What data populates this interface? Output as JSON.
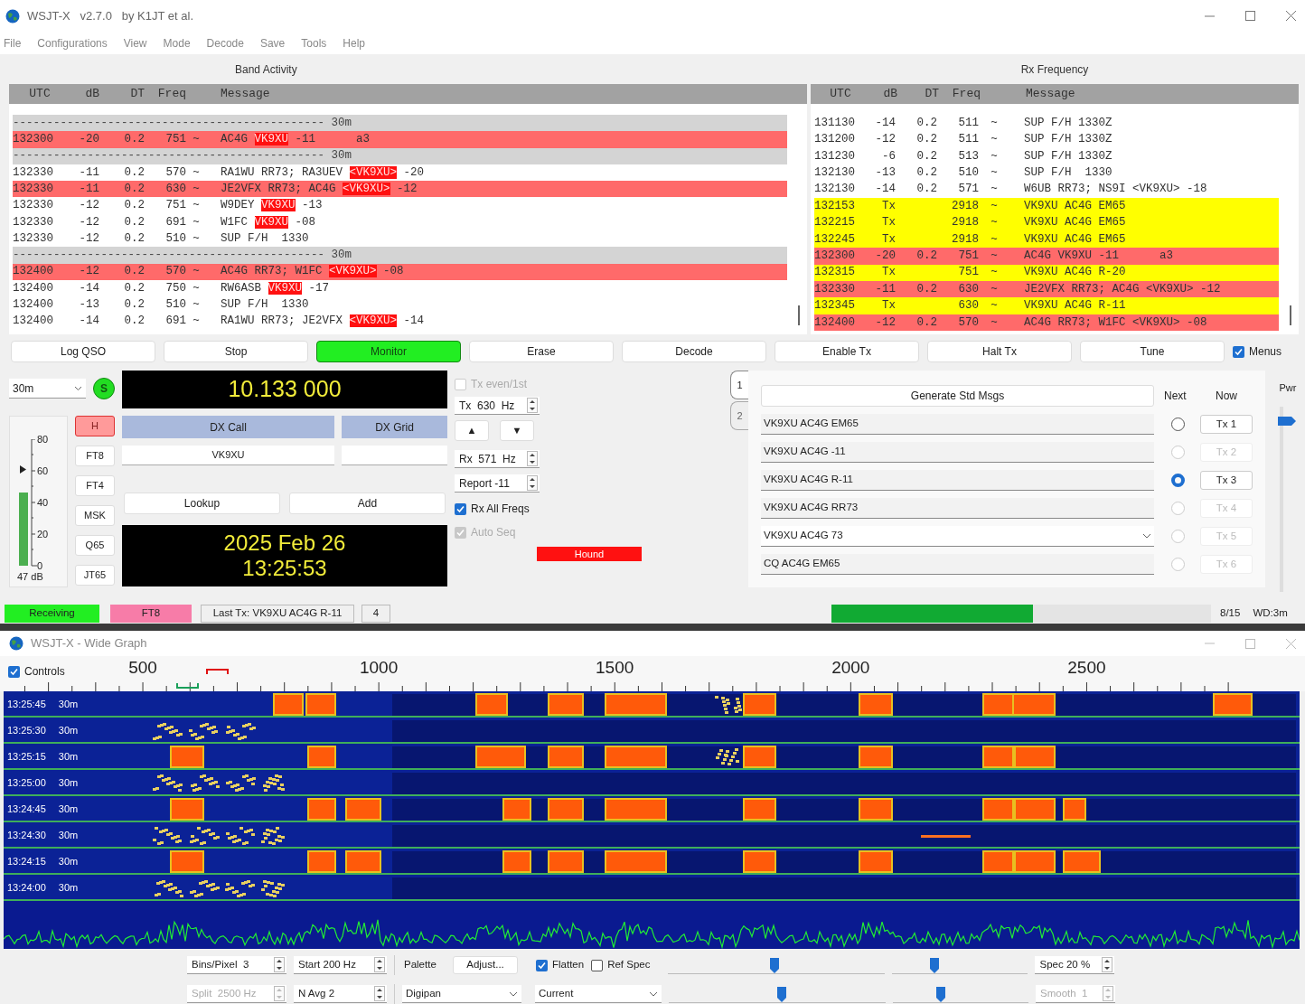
{
  "window": {
    "title": "WSJT-X   v2.7.0   by K1JT et al."
  },
  "menu": [
    "File",
    "Configurations",
    "View",
    "Mode",
    "Decode",
    "Save",
    "Tools",
    "Help"
  ],
  "band_activity": {
    "title": "Band Activity",
    "columns": [
      "UTC",
      "dB",
      "DT",
      "Freq",
      "Message"
    ],
    "rows": [
      {
        "kind": "separator",
        "text": "---------------------------------------------- 30m"
      },
      {
        "kind": "decode",
        "color": "#ff6a6a",
        "utc": "132300",
        "db": "-20",
        "dt": "0.2",
        "freq": "751",
        "sync": "~",
        "message": "AC4G ",
        "call": "VK9XU",
        "after": " -11      a3"
      },
      {
        "kind": "separator",
        "text": "---------------------------------------------- 30m"
      },
      {
        "kind": "decode",
        "color": "#ffffff",
        "utc": "132330",
        "db": "-11",
        "dt": "0.2",
        "freq": "570",
        "sync": "~",
        "message": "RA1WU RR73; RA3UEV ",
        "call": "<VK9XU>",
        "after": " -20"
      },
      {
        "kind": "decode",
        "color": "#ff6a6a",
        "utc": "132330",
        "db": "-11",
        "dt": "0.2",
        "freq": "630",
        "sync": "~",
        "message": "JE2VFX RR73; AC4G ",
        "call": "<VK9XU>",
        "after": " -12"
      },
      {
        "kind": "decode",
        "color": "#ffffff",
        "utc": "132330",
        "db": "-12",
        "dt": "0.2",
        "freq": "751",
        "sync": "~",
        "message": "W9DEY ",
        "call": "VK9XU",
        "after": " -13"
      },
      {
        "kind": "decode",
        "color": "#ffffff",
        "utc": "132330",
        "db": "-12",
        "dt": "0.2",
        "freq": "691",
        "sync": "~",
        "message": "W1FC ",
        "call": "VK9XU",
        "after": " -08"
      },
      {
        "kind": "decode",
        "color": "#ffffff",
        "utc": "132330",
        "db": "-12",
        "dt": "0.2",
        "freq": "510",
        "sync": "~",
        "message": "SUP F/H  1330"
      },
      {
        "kind": "separator",
        "text": "---------------------------------------------- 30m"
      },
      {
        "kind": "decode",
        "color": "#ff6a6a",
        "utc": "132400",
        "db": "-12",
        "dt": "0.2",
        "freq": "570",
        "sync": "~",
        "message": "AC4G RR73; W1FC ",
        "call": "<VK9XU>",
        "after": " -08"
      },
      {
        "kind": "decode",
        "color": "#ffffff",
        "utc": "132400",
        "db": "-14",
        "dt": "0.2",
        "freq": "750",
        "sync": "~",
        "message": "RW6ASB ",
        "call": "VK9XU",
        "after": " -17"
      },
      {
        "kind": "decode",
        "color": "#ffffff",
        "utc": "132400",
        "db": "-13",
        "dt": "0.2",
        "freq": "510",
        "sync": "~",
        "message": "SUP F/H  1330"
      },
      {
        "kind": "decode",
        "color": "#ffffff",
        "utc": "132400",
        "db": "-14",
        "dt": "0.2",
        "freq": "691",
        "sync": "~",
        "message": "RA1WU RR73; JE2VFX ",
        "call": "<VK9XU>",
        "after": " -14"
      }
    ]
  },
  "rx_frequency": {
    "title": "Rx Frequency",
    "columns": [
      "UTC",
      "dB",
      "DT",
      "Freq",
      "Message"
    ],
    "rows": [
      {
        "kind": "decode",
        "color": "#ffffff",
        "utc": "131130",
        "db": "-14",
        "dt": "0.2",
        "freq": "511",
        "sync": "~",
        "message": "SUP F/H 1330Z"
      },
      {
        "kind": "decode",
        "color": "#ffffff",
        "utc": "131200",
        "db": "-12",
        "dt": "0.2",
        "freq": "511",
        "sync": "~",
        "message": "SUP F/H 1330Z"
      },
      {
        "kind": "decode",
        "color": "#ffffff",
        "utc": "131230",
        "db": "-6",
        "dt": "0.2",
        "freq": "513",
        "sync": "~",
        "message": "SUP F/H 1330Z"
      },
      {
        "kind": "decode",
        "color": "#ffffff",
        "utc": "132130",
        "db": "-13",
        "dt": "0.2",
        "freq": "510",
        "sync": "~",
        "message": "SUP F/H  1330"
      },
      {
        "kind": "decode",
        "color": "#ffffff",
        "utc": "132130",
        "db": "-14",
        "dt": "0.2",
        "freq": "571",
        "sync": "~",
        "message": "W6UB RR73; NS9I <VK9XU> -18"
      },
      {
        "kind": "decode",
        "color": "#ffff00",
        "utc": "132153",
        "db": "Tx",
        "freq": "2918",
        "sync": "~",
        "message": "VK9XU AC4G EM65"
      },
      {
        "kind": "decode",
        "color": "#ffff00",
        "utc": "132215",
        "db": "Tx",
        "freq": "2918",
        "sync": "~",
        "message": "VK9XU AC4G EM65"
      },
      {
        "kind": "decode",
        "color": "#ffff00",
        "utc": "132245",
        "db": "Tx",
        "freq": "2918",
        "sync": "~",
        "message": "VK9XU AC4G EM65"
      },
      {
        "kind": "decode",
        "color": "#ff6a6a",
        "utc": "132300",
        "db": "-20",
        "dt": "0.2",
        "freq": "751",
        "sync": "~",
        "message": "AC4G VK9XU -11      a3"
      },
      {
        "kind": "decode",
        "color": "#ffff00",
        "utc": "132315",
        "db": "Tx",
        "freq": "751",
        "sync": "~",
        "message": "VK9XU AC4G R-20"
      },
      {
        "kind": "decode",
        "color": "#ff6a6a",
        "utc": "132330",
        "db": "-11",
        "dt": "0.2",
        "freq": "630",
        "sync": "~",
        "message": "JE2VFX RR73; AC4G <VK9XU> -12"
      },
      {
        "kind": "decode",
        "color": "#ffff00",
        "utc": "132345",
        "db": "Tx",
        "freq": "630",
        "sync": "~",
        "message": "VK9XU AC4G R-11"
      },
      {
        "kind": "decode",
        "color": "#ff6a6a",
        "utc": "132400",
        "db": "-12",
        "dt": "0.2",
        "freq": "570",
        "sync": "~",
        "message": "AC4G RR73; W1FC <VK9XU> -08"
      }
    ]
  },
  "buttons": [
    {
      "label": "Log QSO",
      "on": false
    },
    {
      "label": "Stop",
      "on": false
    },
    {
      "label": "Monitor",
      "on": true
    },
    {
      "label": "Erase",
      "on": false
    },
    {
      "label": "Decode",
      "on": false
    },
    {
      "label": "Enable Tx",
      "on": false
    },
    {
      "label": "Halt Tx",
      "on": false
    },
    {
      "label": "Tune",
      "on": false
    }
  ],
  "menus_checkbox": {
    "label": "Menus",
    "checked": true
  },
  "band": "30m",
  "s_indicator": "S",
  "dial_frequency": "10.133 000",
  "meter": {
    "ticks": [
      "80",
      "60",
      "40",
      "20",
      "0"
    ],
    "reading": "47 dB"
  },
  "modes": [
    {
      "label": "H",
      "selected": true
    },
    {
      "label": "FT8",
      "selected": false
    },
    {
      "label": "FT4",
      "selected": false
    },
    {
      "label": "MSK",
      "selected": false
    },
    {
      "label": "Q65",
      "selected": false
    },
    {
      "label": "JT65",
      "selected": false
    }
  ],
  "dx": {
    "call_label": "DX Call",
    "grid_label": "DX Grid",
    "call": "VK9XU"
  },
  "lookup": "Lookup",
  "add": "Add",
  "clock": {
    "date": "2025 Feb 26",
    "time": "13:25:53"
  },
  "tx_controls": {
    "tx_even": {
      "label": "Tx even/1st",
      "checked": false,
      "disabled": true
    },
    "tx_freq": "Tx  630  Hz",
    "arrows": [
      "▲",
      "▼"
    ],
    "rx_freq": "Rx  571  Hz",
    "report": "Report -11",
    "rx_all": {
      "label": "Rx All Freqs",
      "checked": true,
      "disabled": false
    },
    "auto_seq": {
      "label": "Auto Seq",
      "checked": true,
      "disabled": true
    },
    "hound": "Hound"
  },
  "tabs": [
    {
      "label": "1",
      "selected": true
    },
    {
      "label": "2",
      "selected": false
    }
  ],
  "messages": {
    "generate": "Generate Std Msgs",
    "next_label": "Next",
    "now_label": "Now",
    "rows": [
      {
        "text": "VK9XU AC4G EM65",
        "next": false,
        "now": "Tx 1",
        "enabled": true,
        "dropdown": false
      },
      {
        "text": "VK9XU AC4G -11",
        "next": false,
        "now": "Tx 2",
        "enabled": false,
        "dropdown": false
      },
      {
        "text": "VK9XU AC4G R-11",
        "next": true,
        "now": "Tx 3",
        "enabled": true,
        "dropdown": false
      },
      {
        "text": "VK9XU AC4G RR73",
        "next": false,
        "now": "Tx 4",
        "enabled": false,
        "dropdown": false
      },
      {
        "text": "VK9XU AC4G 73",
        "next": false,
        "now": "Tx 5",
        "enabled": false,
        "dropdown": true
      },
      {
        "text": "CQ AC4G EM65",
        "next": false,
        "now": "Tx 6",
        "enabled": false,
        "dropdown": false
      }
    ]
  },
  "power": {
    "label": "Pwr",
    "level": 0.95
  },
  "status_bar": {
    "state": "Receiving",
    "mode": "FT8",
    "last_tx": "Last Tx: VK9XU AC4G R-11",
    "count": "4",
    "progress": {
      "level": 0.53
    },
    "period": "8/15",
    "watchdog": "WD:3m"
  },
  "wide_graph": {
    "title": "WSJT-X - Wide Graph",
    "controls": {
      "label": "Controls",
      "checked": true
    },
    "scale": [
      "500",
      "1000",
      "1500",
      "2000",
      "2500"
    ],
    "lines": [
      {
        "time": "13:25:45",
        "band": "30m"
      },
      {
        "time": "13:25:30",
        "band": "30m"
      },
      {
        "time": "13:25:15",
        "band": "30m"
      },
      {
        "time": "13:25:00",
        "band": "30m"
      },
      {
        "time": "13:24:45",
        "band": "30m"
      },
      {
        "time": "13:24:30",
        "band": "30m"
      },
      {
        "time": "13:24:15",
        "band": "30m"
      },
      {
        "time": "13:24:00",
        "band": "30m"
      }
    ]
  },
  "graph_controls": {
    "bins": {
      "text": "Bins/Pixel  3",
      "disabled": false
    },
    "start": {
      "text": "Start 200 Hz",
      "disabled": false
    },
    "palette_label": "Palette",
    "adjust": "Adjust...",
    "flatten": {
      "label": "Flatten",
      "checked": true
    },
    "ref_spec": {
      "label": "Ref Spec",
      "checked": false
    },
    "sliders": [
      {
        "level": 0.49
      },
      {
        "level": 0.31
      },
      {
        "level": 0.52
      },
      {
        "level": 0.35
      }
    ],
    "spec": {
      "text": "Spec 20 %",
      "disabled": false
    },
    "split": {
      "text": "Split  2500 Hz",
      "disabled": true
    },
    "navg": {
      "text": "N Avg 2",
      "disabled": false
    },
    "palette": "Digipan",
    "spectrum": "Current",
    "smooth": {
      "text": "Smooth  1",
      "disabled": true
    }
  }
}
